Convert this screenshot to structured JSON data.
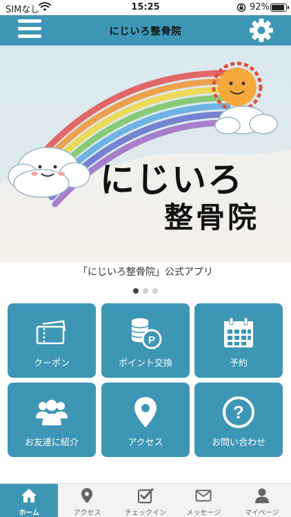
{
  "status_bar": {
    "carrier": "SIMなし",
    "time": "15:25",
    "battery": "92%",
    "battery_level": 0.92
  },
  "header": {
    "title": "にじいろ整骨院",
    "menu_icon": "hamburger-menu-icon",
    "settings_icon": "gear-icon"
  },
  "hero": {
    "logo_line1": "にじいろ",
    "logo_line2": "整骨院",
    "caption": "「にじいろ整骨院」公式アプリ",
    "slide_count": 3,
    "active_slide": 1
  },
  "tiles": [
    {
      "label": "クーポン",
      "icon": "coupon-ticket-icon"
    },
    {
      "label": "ポイント交換",
      "icon": "point-coins-icon"
    },
    {
      "label": "予約",
      "icon": "calendar-icon"
    },
    {
      "label": "お友達に紹介",
      "icon": "friends-group-icon"
    },
    {
      "label": "アクセス",
      "icon": "map-pin-icon"
    },
    {
      "label": "お問い合わせ",
      "icon": "question-icon"
    }
  ],
  "tabbar": [
    {
      "label": "ホーム",
      "icon": "home-icon",
      "active": true
    },
    {
      "label": "アクセス",
      "icon": "map-pin-icon",
      "active": false
    },
    {
      "label": "チェックイン",
      "icon": "checkin-icon",
      "active": false
    },
    {
      "label": "メッセージ",
      "icon": "envelope-icon",
      "active": false
    },
    {
      "label": "マイページ",
      "icon": "user-icon",
      "active": false
    }
  ],
  "colors": {
    "accent": "#3e96b5",
    "tab_inactive": "#666666",
    "background": "#ffffff"
  }
}
